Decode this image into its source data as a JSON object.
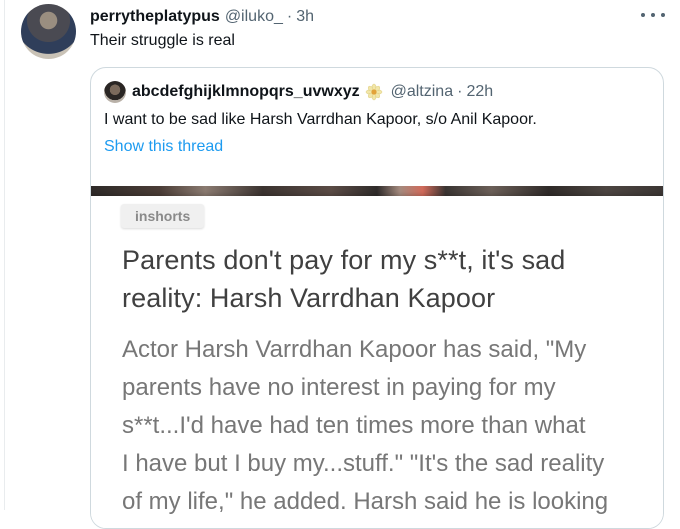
{
  "tweet": {
    "name": "perrytheplatypus",
    "handle": "@iluko_",
    "separator": "·",
    "time": "3h",
    "text": "Their struggle is real"
  },
  "quoted": {
    "name": "abcdefghijklmnopqrs_uvwxyz",
    "handle": "@altzina",
    "separator": "·",
    "time": "22h",
    "text": "I want to be sad like Harsh Varrdhan Kapoor, s/o Anil Kapoor.",
    "show_thread": "Show this thread",
    "article": {
      "source": "inshorts",
      "headline_lines": [
        "Parents don't pay for my s**t, it's sad",
        "reality: Harsh Varrdhan Kapoor"
      ],
      "body_lines": [
        "Actor Harsh Varrdhan Kapoor has said, \"My",
        "parents have no interest in paying for my",
        "s**t...I'd have had ten times more than what",
        "I have but I buy my...stuff.\" \"It's the sad reality",
        "of my life,\" he added. Harsh said he is looking"
      ]
    }
  },
  "icons": {
    "more": "more-horizontal-icon",
    "verified_flower": "flower-emoji-icon"
  },
  "colors": {
    "link": "#1d9bf0",
    "secondary_text": "#536471",
    "border": "#cfd9de"
  }
}
